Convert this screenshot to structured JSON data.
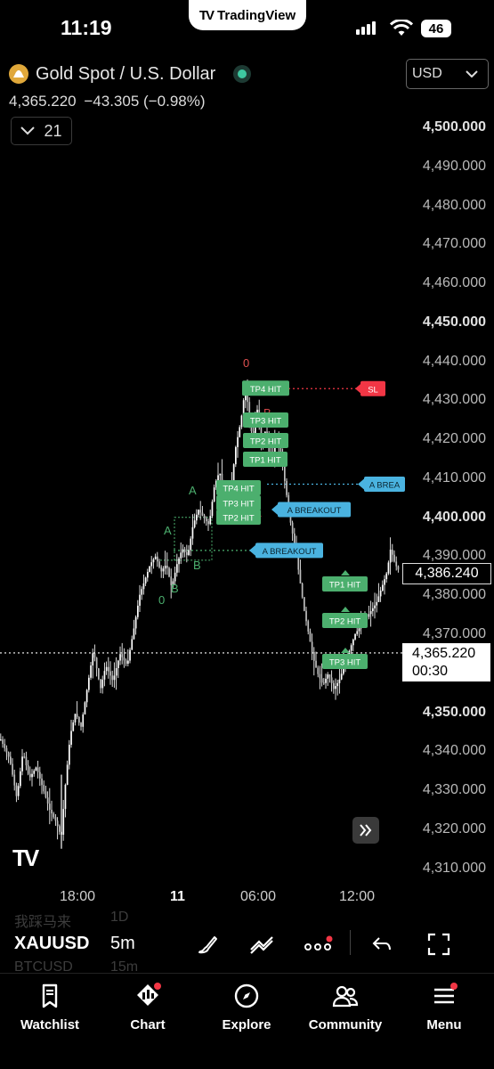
{
  "status_bar": {
    "time": "11:19",
    "battery": "46"
  },
  "app_pill": {
    "brand": "TradingView"
  },
  "header": {
    "symbol_title": "Gold Spot / U.S. Dollar",
    "last_price": "4,365.220",
    "change": "−43.305",
    "change_pct": "(−0.98%)",
    "indicator_count": "21",
    "currency": "USD"
  },
  "price_axis": {
    "labels": [
      {
        "text": "4,500.000",
        "bold": true
      },
      {
        "text": "4,490.000",
        "bold": false
      },
      {
        "text": "4,480.000",
        "bold": false
      },
      {
        "text": "4,470.000",
        "bold": false
      },
      {
        "text": "4,460.000",
        "bold": false
      },
      {
        "text": "4,450.000",
        "bold": true
      },
      {
        "text": "4,440.000",
        "bold": false
      },
      {
        "text": "4,430.000",
        "bold": false
      },
      {
        "text": "4,420.000",
        "bold": false
      },
      {
        "text": "4,410.000",
        "bold": false
      },
      {
        "text": "4,400.000",
        "bold": true
      },
      {
        "text": "4,390.000",
        "bold": false
      },
      {
        "text": "4,380.000",
        "bold": false
      },
      {
        "text": "4,370.000",
        "bold": false
      },
      {
        "text": "4,350.000",
        "bold": true
      },
      {
        "text": "4,340.000",
        "bold": false
      },
      {
        "text": "4,330.000",
        "bold": false
      },
      {
        "text": "4,320.000",
        "bold": false
      },
      {
        "text": "4,310.000",
        "bold": false
      }
    ],
    "marker_price": "4,386.240",
    "current_price": "4,365.220",
    "countdown": "00:30"
  },
  "time_axis": {
    "labels": [
      "18:00",
      "11",
      "06:00",
      "12:00"
    ]
  },
  "annotations": {
    "sl": "SL",
    "tp4": "TP4 HIT",
    "tp3": "TP3 HIT",
    "tp2": "TP2 HIT",
    "tp1": "TP1 HIT",
    "breakout": "A BREAKOUT",
    "breakout_cut": "A BREA",
    "zero": "0",
    "a": "A",
    "b": "B"
  },
  "toolbar": {
    "symbol": "XAUUSD",
    "interval": "5m",
    "ghost_prev_symbol": "我踩马来",
    "ghost_prev_interval": "1D",
    "ghost_next_symbol": "BTCUSD",
    "ghost_next_interval": "15m"
  },
  "nav": {
    "items": [
      {
        "label": "Watchlist",
        "icon": "bookmark-icon"
      },
      {
        "label": "Chart",
        "icon": "chart-icon"
      },
      {
        "label": "Explore",
        "icon": "compass-icon"
      },
      {
        "label": "Community",
        "icon": "people-icon"
      },
      {
        "label": "Menu",
        "icon": "menu-icon"
      }
    ]
  },
  "colors": {
    "background": "#000000",
    "tp_green": "#4caf6e",
    "sl_red": "#f23645",
    "breakout_blue": "#4ab3e0",
    "live_dot": "#3ec7a0"
  }
}
